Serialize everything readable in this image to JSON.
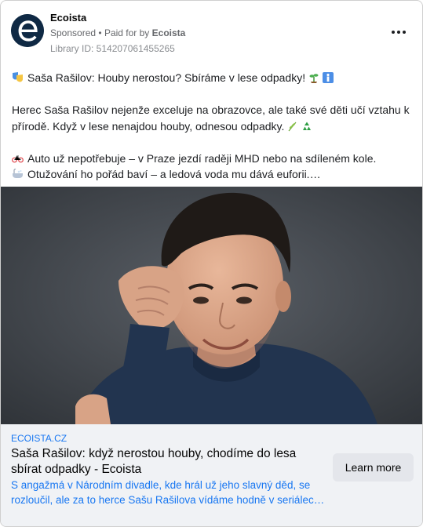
{
  "advertiser": {
    "name": "Ecoista",
    "sponsored_label": "Sponsored",
    "separator": "•",
    "paid_for_prefix": "Paid for by",
    "paid_for_name": "Ecoista",
    "library_id": "Library ID: 514207061455265",
    "avatar_icon": "ecoista-logo-e",
    "brand_color": "#0f2944"
  },
  "menu": {
    "icon": "more-horizontal-icon"
  },
  "post": {
    "line1": "Saša Rašilov: Houby nerostou? Sbíráme v lese odpadky!",
    "line2": "Herec Saša Rašilov nejenže exceluje na obrazovce, ale také své děti učí vztahu k přírodě. Když v lese nenajdou houby, odnesou odpadky.",
    "line3": "Auto už nepotřebuje – v Praze jezdí raději MHD nebo na sdíleném kole.",
    "line4": "Otužování ho pořád baví – a ledová voda mu dává euforii.…",
    "icons": {
      "line1_lead": "masks-emoji",
      "line1_trail_1": "seedling-emoji",
      "line1_trail_2": "person-emoji",
      "line2_trail_1": "herb-emoji",
      "line2_trail_2": "recycle-emoji",
      "line3_lead": "bicycle-emoji",
      "line4_lead": "bathtub-emoji"
    }
  },
  "image": {
    "subject": "portrait photo of a smiling man in a navy sweater"
  },
  "link_card": {
    "domain": "ECOISTA.CZ",
    "headline": "Saša Rašilov: když nerostou houby, chodíme do lesa sbírat odpadky - Ecoista",
    "description": "S angažmá v Národním divadle, kde hrál už jeho slavný děd, se rozloučil, ale za to herce Sašu Rašilova vídáme hodně v seriálec…",
    "cta_label": "Learn more",
    "link_color": "#1877f2"
  }
}
